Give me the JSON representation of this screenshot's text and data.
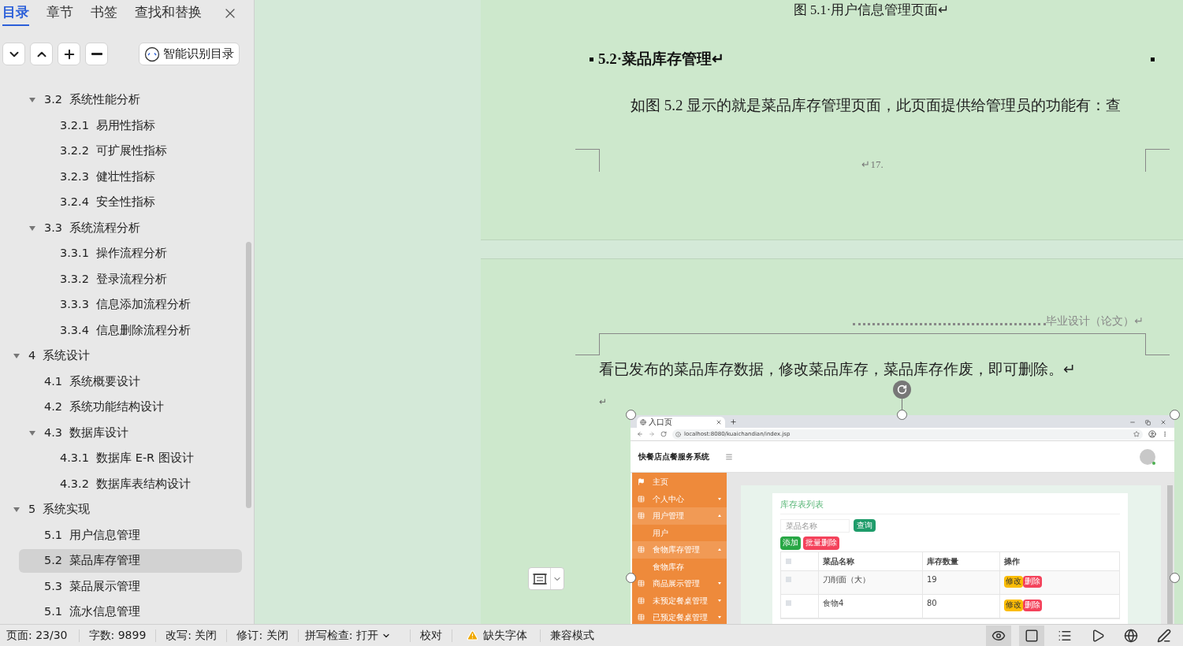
{
  "nav_pane": {
    "tabs": [
      {
        "label": "目录",
        "selected": true
      },
      {
        "label": "章节",
        "selected": false
      },
      {
        "label": "书签",
        "selected": false
      },
      {
        "label": "查找和替换",
        "selected": false
      }
    ],
    "smart_toc_button": "智能识别目录",
    "toc": [
      {
        "label": "3.2  系统性能分析",
        "kind": "section",
        "expanded": true,
        "selected": false,
        "children": [
          {
            "label": "3.2.1  易用性指标",
            "selected": false
          },
          {
            "label": "3.2.2  可扩展性指标",
            "selected": false
          },
          {
            "label": "3.2.3  健壮性指标",
            "selected": false
          },
          {
            "label": "3.2.4  安全性指标",
            "selected": false
          }
        ]
      },
      {
        "label": "3.3  系统流程分析",
        "kind": "section",
        "expanded": true,
        "selected": false,
        "children": [
          {
            "label": "3.3.1  操作流程分析",
            "selected": false
          },
          {
            "label": "3.3.2  登录流程分析",
            "selected": false
          },
          {
            "label": "3.3.3  信息添加流程分析",
            "selected": false
          },
          {
            "label": "3.3.4  信息删除流程分析",
            "selected": false
          }
        ]
      },
      {
        "label": "4  系统设计",
        "kind": "chapter",
        "expanded": true,
        "selected": false,
        "children": [
          {
            "label": "4.1  系统概要设计",
            "selected": false
          },
          {
            "label": "4.2  系统功能结构设计",
            "selected": false
          },
          {
            "label": "4.3  数据库设计",
            "expanded": true,
            "selected": false,
            "children": [
              {
                "label": "4.3.1  数据库 E-R 图设计",
                "selected": false
              },
              {
                "label": "4.3.2  数据库表结构设计",
                "selected": false
              }
            ]
          }
        ]
      },
      {
        "label": "5  系统实现",
        "kind": "chapter",
        "expanded": true,
        "selected": false,
        "children": [
          {
            "label": "5.1  用户信息管理",
            "selected": false
          },
          {
            "label": "5.2  菜品库存管理",
            "selected": true
          },
          {
            "label": "5.3  菜品展示管理",
            "selected": false
          },
          {
            "label": "5.1  流水信息管理",
            "selected": false
          }
        ]
      }
    ]
  },
  "document": {
    "page_1": {
      "caption": "图 5.1·用户信息管理页面↵",
      "heading": "5.2·菜品库存管理↵",
      "paragraph": "如图 5.2 显示的就是菜品库存管理页面，此页面提供给管理员的功能有：查",
      "page_number": "↵17."
    },
    "page_2": {
      "header": "毕业设计（论文）↵",
      "paragraph": "看已发布的菜品库存数据，修改菜品库存，菜品库存作废，即可删除。↵",
      "empty_paragraph": "↵",
      "figure": {
        "tab_title": "入口页",
        "url": "localhost:8080/kuaichandian/index.jsp",
        "app_title": "快餐店点餐服务系统",
        "menu": [
          {
            "label": "主页",
            "kind": "home"
          },
          {
            "label": "个人中心",
            "kind": "group",
            "expanded": false
          },
          {
            "label": "用户管理",
            "kind": "group",
            "expanded": true
          },
          {
            "label": "用户",
            "kind": "sub"
          },
          {
            "label": "食物库存管理",
            "kind": "group",
            "expanded": true
          },
          {
            "label": "食物库存",
            "kind": "sub"
          },
          {
            "label": "商品展示管理",
            "kind": "group",
            "expanded": false
          },
          {
            "label": "未预定餐桌管理",
            "kind": "group",
            "expanded": false
          },
          {
            "label": "已预定餐桌管理",
            "kind": "group",
            "expanded": false
          }
        ],
        "panel_title": "库存表列表",
        "search_placeholder": "菜品名称",
        "search_button": "查询",
        "add_button": "添加",
        "bulk_delete_button": "批量删除",
        "header_checked": false,
        "columns": [
          "菜品名称",
          "库存数量",
          "操作"
        ],
        "rows": [
          {
            "checked": false,
            "name": "刀削面（大）",
            "quantity": "19",
            "actions": [
              {
                "label": "修改",
                "kind": "edit"
              },
              {
                "label": "删除",
                "kind": "delete"
              }
            ]
          },
          {
            "checked": false,
            "name": "食物4",
            "quantity": "80",
            "actions": [
              {
                "label": "修改",
                "kind": "edit"
              },
              {
                "label": "删除",
                "kind": "delete"
              }
            ]
          }
        ]
      }
    }
  },
  "status_bar": {
    "items": [
      {
        "label": "页面: 23/30",
        "kind": "text"
      },
      {
        "label": "字数: 9899",
        "kind": "text"
      },
      {
        "label": "改写: 关闭",
        "kind": "text"
      },
      {
        "label": "修订: 关闭",
        "kind": "text"
      },
      {
        "label": "拼写检查: 打开",
        "kind": "dropdown"
      },
      {
        "label": "校对",
        "kind": "text"
      },
      {
        "label": "缺失字体",
        "kind": "warning"
      },
      {
        "label": "兼容模式",
        "kind": "text"
      }
    ],
    "view_buttons": [
      {
        "kind": "eye",
        "selected": true
      },
      {
        "kind": "page",
        "selected": true
      },
      {
        "kind": "outline",
        "selected": false
      },
      {
        "kind": "play",
        "selected": false
      },
      {
        "kind": "web",
        "selected": false
      },
      {
        "kind": "pen",
        "selected": false
      }
    ]
  }
}
